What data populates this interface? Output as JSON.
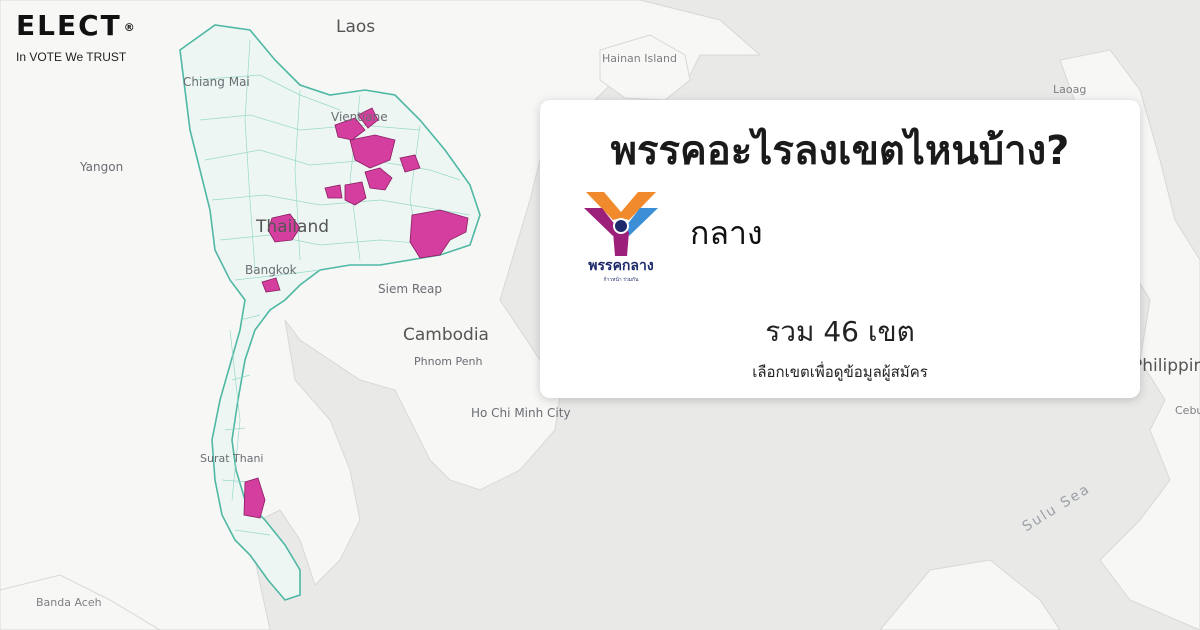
{
  "brand": {
    "logo": "ELECT",
    "reg_mark": "®",
    "tagline": "In VOTE We TRUST"
  },
  "card": {
    "title": "พรรคอะไรลงเขตไหนบ้าง?",
    "party_name": "กลาง",
    "party_logo_text": "พรรคกลาง",
    "party_logo_subtext": "ก้าวหน้า ร่วมกัน",
    "total": "รวม 46 เขต",
    "hint": "เลือกเขตเพื่อดูข้อมูลผู้สมัคร"
  },
  "map": {
    "labels": {
      "laos": "Laos",
      "hainan": "Hainan Island",
      "laoag": "Laoag",
      "chiang_mai": "Chiang Mai",
      "vientiane": "Vientiane",
      "yangon": "Yangon",
      "thailand": "Thailand",
      "bangkok": "Bangkok",
      "siem_reap": "Siem Reap",
      "cambodia": "Cambodia",
      "phnom_penh": "Phnom Penh",
      "hcmc": "Ho Chi Minh City",
      "philippines": "Philippines",
      "cebu": "Cebu",
      "surat_thani": "Surat Thani",
      "sulu_sea": "Sulu Sea",
      "banda_aceh": "Banda Aceh"
    },
    "colors": {
      "land": "#f7f7f6",
      "water": "#e9e9e8",
      "district_border": "#7fd0bf",
      "highlight": "#d43e9e",
      "highlight_border": "#8a1e63"
    }
  }
}
